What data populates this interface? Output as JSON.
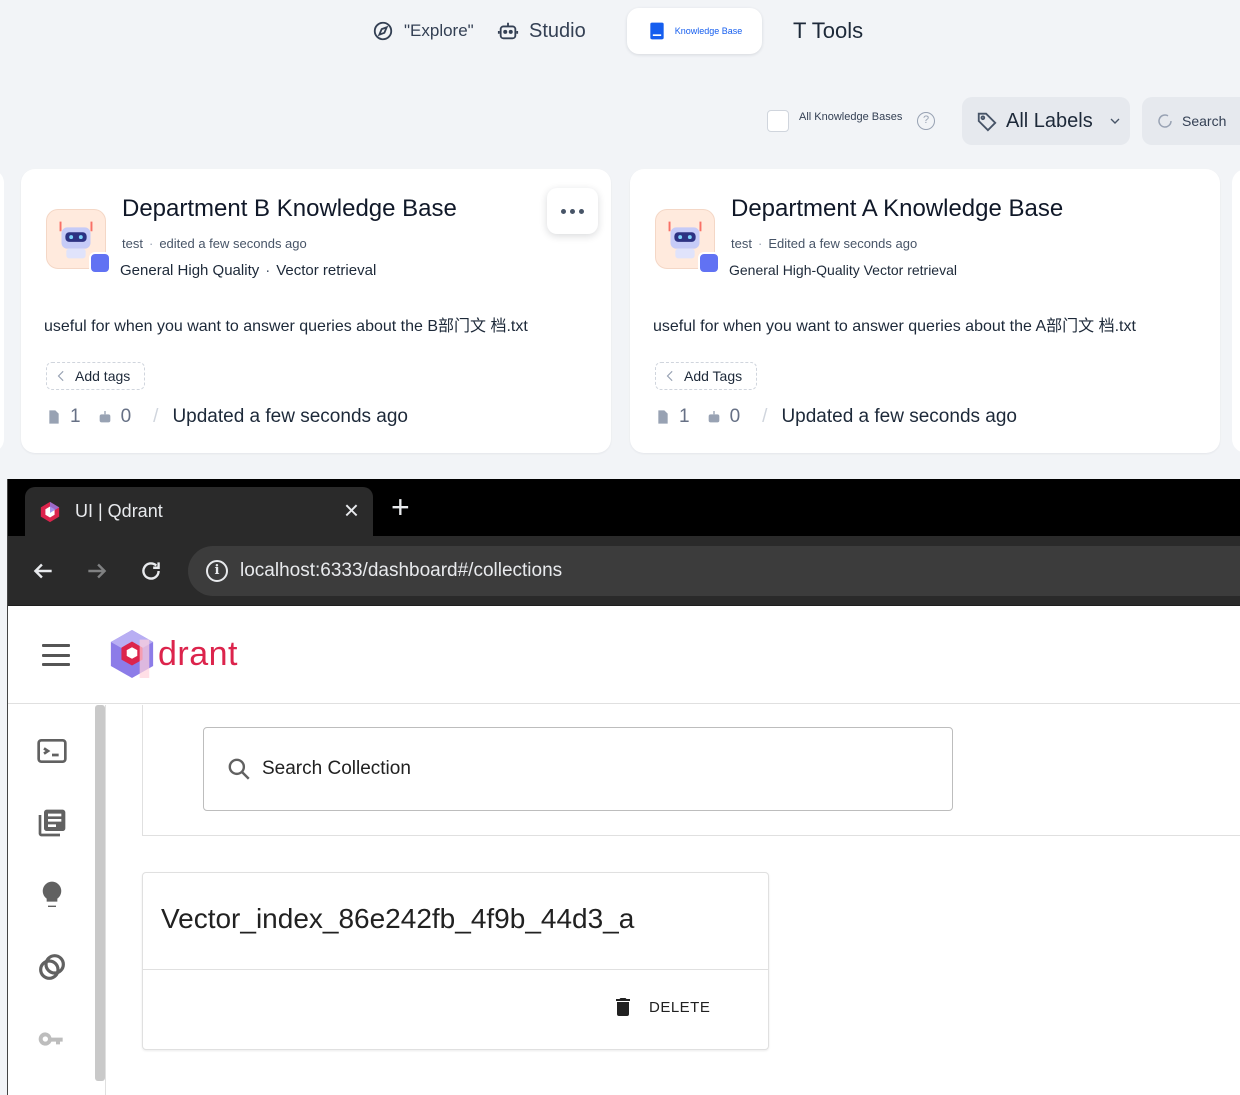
{
  "topnav": {
    "items": [
      {
        "label": "\"Explore\"",
        "icon": "compass-icon"
      },
      {
        "label": "Studio",
        "icon": "robot-icon"
      },
      {
        "label": "Knowledge Base",
        "icon": "book-icon",
        "active": true
      },
      {
        "label": "T Tools",
        "icon": "tools-icon"
      }
    ]
  },
  "filter": {
    "all_kb_label": "All Knowledge Bases",
    "help": "?",
    "labels_button": "All Labels",
    "search_placeholder": "Search"
  },
  "cards": [
    {
      "title": "Department B Knowledge Base",
      "author": "test",
      "edited": "edited a few seconds ago",
      "mode_a": "General High Quality",
      "mode_b": "Vector retrieval",
      "description": "useful for when you want to answer queries about the B部门文 档.txt",
      "tag_button": "Add tags",
      "docs": "1",
      "apps": "0",
      "updated": "Updated a few seconds ago"
    },
    {
      "title": "Department A Knowledge Base",
      "author": "test",
      "edited": "Edited a few seconds ago",
      "mode": "General High-Quality Vector retrieval",
      "description": "useful for when you want to answer queries about the A部门文 档.txt",
      "tag_button": "Add Tags",
      "docs": "1",
      "apps": "0",
      "updated": "Updated a few seconds ago"
    }
  ],
  "browser": {
    "tab_title": "UI | Qdrant",
    "close": "×",
    "new_tab": "+",
    "url": "localhost:6333/dashboard#/collections",
    "info": "i"
  },
  "qdrant": {
    "logo_text": "drant",
    "search_placeholder": "Search Collection",
    "collection_name": "Vector_index_86e242fb_4f9b_44d3_a",
    "delete_label": "DELETE",
    "sidebar_icons": [
      "console-icon",
      "collections-icon",
      "tutorial-icon",
      "datasets-icon",
      "api-key-icon"
    ]
  },
  "colors": {
    "accent_blue": "#155eef",
    "qdrant_red": "#dc244c",
    "badge_purple": "#6172f3"
  }
}
